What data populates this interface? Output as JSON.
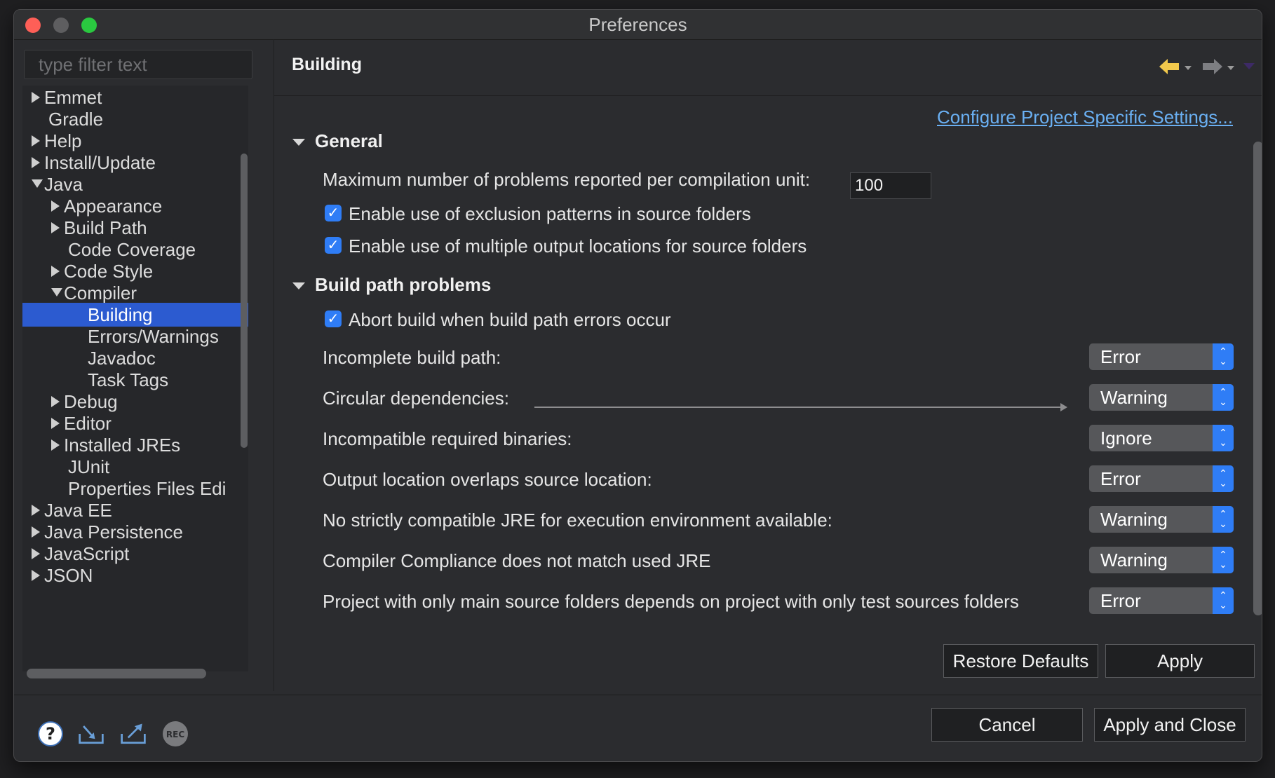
{
  "window": {
    "title": "Preferences"
  },
  "filter": {
    "placeholder": "type filter text"
  },
  "tree": [
    {
      "label": "Emmet",
      "expander": "closed",
      "depth": 0
    },
    {
      "label": "Gradle",
      "expander": "none",
      "depth": 0
    },
    {
      "label": "Help",
      "expander": "closed",
      "depth": 0
    },
    {
      "label": "Install/Update",
      "expander": "closed",
      "depth": 0
    },
    {
      "label": "Java",
      "expander": "open",
      "depth": 0
    },
    {
      "label": "Appearance",
      "expander": "closed",
      "depth": 1
    },
    {
      "label": "Build Path",
      "expander": "closed",
      "depth": 1
    },
    {
      "label": "Code Coverage",
      "expander": "none",
      "depth": 1
    },
    {
      "label": "Code Style",
      "expander": "closed",
      "depth": 1
    },
    {
      "label": "Compiler",
      "expander": "open",
      "depth": 1
    },
    {
      "label": "Building",
      "expander": "none",
      "depth": 2,
      "selected": true
    },
    {
      "label": "Errors/Warnings",
      "expander": "none",
      "depth": 2
    },
    {
      "label": "Javadoc",
      "expander": "none",
      "depth": 2
    },
    {
      "label": "Task Tags",
      "expander": "none",
      "depth": 2
    },
    {
      "label": "Debug",
      "expander": "closed",
      "depth": 1
    },
    {
      "label": "Editor",
      "expander": "closed",
      "depth": 1
    },
    {
      "label": "Installed JREs",
      "expander": "closed",
      "depth": 1
    },
    {
      "label": "JUnit",
      "expander": "none",
      "depth": 1
    },
    {
      "label": "Properties Files Edi",
      "expander": "none",
      "depth": 1
    },
    {
      "label": "Java EE",
      "expander": "closed",
      "depth": 0
    },
    {
      "label": "Java Persistence",
      "expander": "closed",
      "depth": 0
    },
    {
      "label": "JavaScript",
      "expander": "closed",
      "depth": 0
    },
    {
      "label": "JSON",
      "expander": "closed",
      "depth": 0
    }
  ],
  "page": {
    "title": "Building",
    "configure_link": "Configure Project Specific Settings...",
    "general": {
      "heading": "General",
      "max_problems_label": "Maximum number of problems reported per compilation unit:",
      "max_problems_value": "100",
      "cb_exclusion": "Enable use of exclusion patterns in source folders",
      "cb_multiple_output": "Enable use of multiple output locations for source folders"
    },
    "build_path": {
      "heading": "Build path problems",
      "cb_abort": "Abort build when build path errors occur",
      "rows": [
        {
          "label": "Incomplete build path:",
          "value": "Error"
        },
        {
          "label": "Circular dependencies:",
          "value": "Warning"
        },
        {
          "label": "Incompatible required binaries:",
          "value": "Ignore"
        },
        {
          "label": "Output location overlaps source location:",
          "value": "Error"
        },
        {
          "label": "No strictly compatible JRE for execution environment available:",
          "value": "Warning"
        },
        {
          "label": "Compiler Compliance does not match used JRE",
          "value": "Warning"
        },
        {
          "label": "Project with only main source folders depends on project with only test sources folders",
          "value": "Error"
        }
      ]
    },
    "restore_defaults": "Restore Defaults",
    "apply": "Apply"
  },
  "footer": {
    "cancel": "Cancel",
    "apply_close": "Apply and Close",
    "icons": [
      "help-icon",
      "import-icon",
      "export-icon",
      "record-icon"
    ],
    "record_icon_text": "REC"
  },
  "colors": {
    "accent": "#2f7df6",
    "selection": "#2c5bd0",
    "link": "#6ab0f3"
  }
}
